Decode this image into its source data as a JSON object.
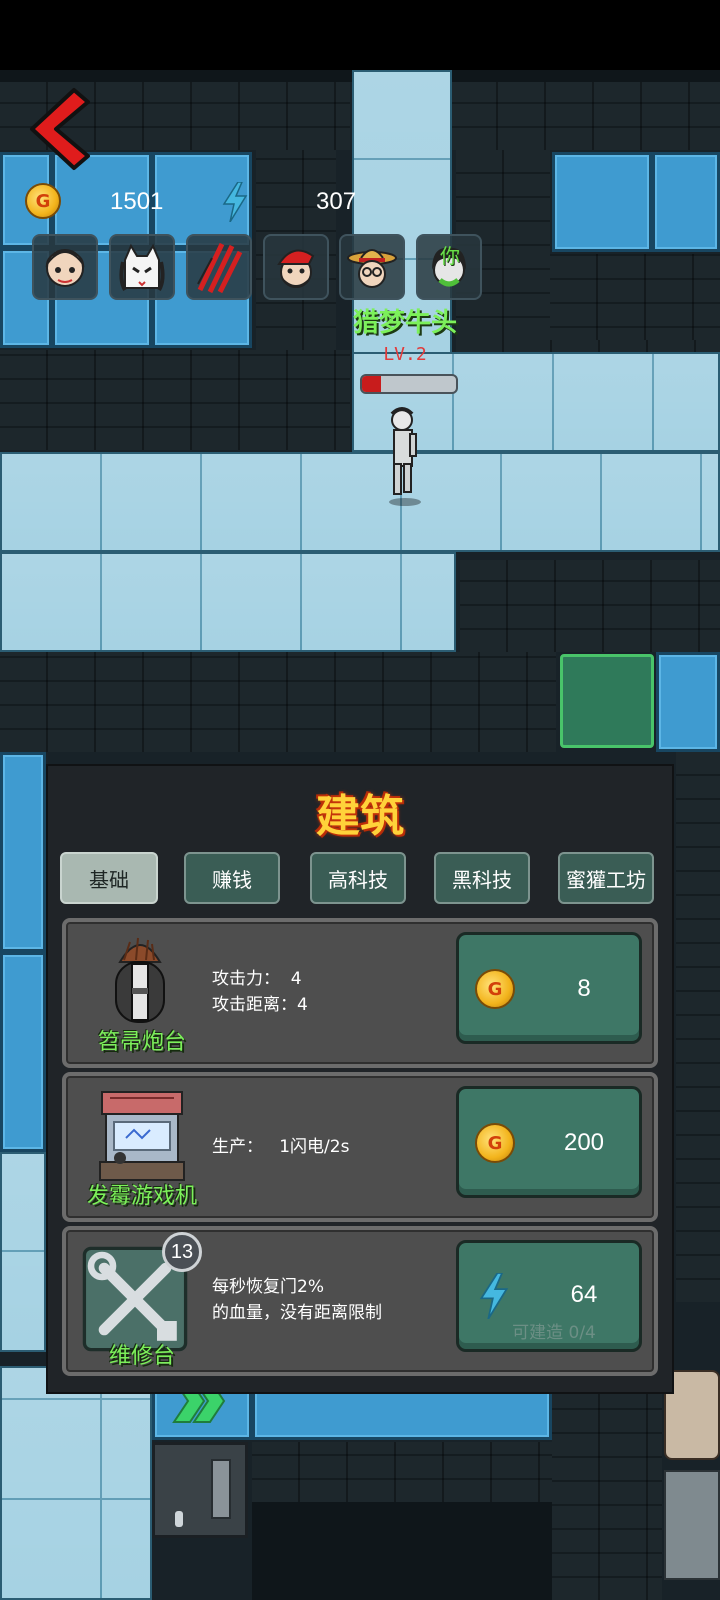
{
  "hud": {
    "back_icon": "back-arrow-icon",
    "gold": "1501",
    "energy": "307",
    "coin_letter": "G",
    "avatars": [
      "grandma-avatar",
      "cat-mask-avatar",
      "claw-avatar",
      "santa-avatar",
      "straw-hat-avatar",
      "ghost-avatar"
    ],
    "avatar_tag": "你"
  },
  "player": {
    "name": "猎梦牛头",
    "level": "LV.2",
    "hp_fraction": 0.2
  },
  "panel": {
    "title": "建筑",
    "tabs": [
      "基础",
      "赚钱",
      "高科技",
      "黑科技",
      "蜜獾工坊"
    ],
    "active_tab": 0,
    "items": [
      {
        "name": "笤帚炮台",
        "icon": "broom-turret-icon",
        "stats": "攻击力：  4\n攻击距离：4",
        "currency": "coin",
        "price": "8",
        "sub": ""
      },
      {
        "name": "发霉游戏机",
        "icon": "arcade-machine-icon",
        "stats": "生产：   1闪电/2s",
        "currency": "coin",
        "price": "200",
        "sub": ""
      },
      {
        "name": "维修台",
        "icon": "wrench-tools-icon",
        "stats": "每秒恢复门2%\n的血量，没有距离限制",
        "currency": "energy",
        "price": "64",
        "sub": "可建造 0/4",
        "badge": "13"
      }
    ]
  },
  "colors": {
    "accent_green": "#7cf05a",
    "title_gold": "#ffd23a",
    "button_teal": "#3e7766"
  }
}
